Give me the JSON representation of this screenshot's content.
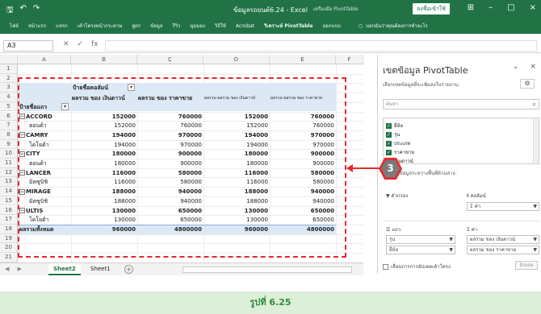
{
  "window": {
    "title": "ข้อมูลรถยนต์6.24 - Excel",
    "context_tab": "เครื่องมือ PivotTable",
    "signin": "ลงชื่อเข้าใช้",
    "controls": [
      "⊞",
      "–",
      "□",
      "×"
    ]
  },
  "quick_access": [
    "🖫",
    "↶",
    "↷"
  ],
  "ribbon_tabs": [
    "ไฟล์",
    "หน้าแรก",
    "แทรก",
    "เค้าโครงหน้ากระดาษ",
    "สูตร",
    "ข้อมูล",
    "รีวิว",
    "มุมมอง",
    "วิธีใช้",
    "Acrobat",
    "วิเคราะห์ PivotTable",
    "ออกแบบ"
  ],
  "tellme": "บอกฉันว่าคุณต้องการทำอะไร",
  "formula_bar": {
    "name_box": "A3",
    "icons": [
      "✕",
      "✓",
      "fx"
    ],
    "content": ""
  },
  "grid": {
    "columns": [
      "A",
      "B",
      "C",
      "D",
      "E",
      "F"
    ],
    "rows": [
      "1",
      "2",
      "3",
      "4",
      "5",
      "6",
      "7",
      "8",
      "9",
      "10",
      "11",
      "12",
      "13",
      "14",
      "15",
      "16",
      "17",
      "18",
      "19",
      "20",
      "21"
    ],
    "pivot": {
      "col_field_label": "ป้ายชื่อคอลัมน์",
      "row_field_label": "ป้ายชื่อแถว",
      "value_headers": [
        "ผลรวม ของ เงินดาวน์",
        "ผลรวม ของ ราคาขาย",
        "ผลรวม ผลรวม ของ เงินดาวน์",
        "ผลรวม ผลรวม ของ ราคาขาย"
      ],
      "rows": [
        {
          "label": "ACCORD",
          "bold": true,
          "values": [
            "152000",
            "760000",
            "152000",
            "760000"
          ]
        },
        {
          "label": "ฮอนด้า",
          "bold": false,
          "values": [
            "152000",
            "760000",
            "152000",
            "760000"
          ]
        },
        {
          "label": "CAMRY",
          "bold": true,
          "values": [
            "194000",
            "970000",
            "194000",
            "970000"
          ]
        },
        {
          "label": "โตโยต้า",
          "bold": false,
          "values": [
            "194000",
            "970000",
            "194000",
            "970000"
          ]
        },
        {
          "label": "CITY",
          "bold": true,
          "values": [
            "180000",
            "900000",
            "180000",
            "900000"
          ]
        },
        {
          "label": "ฮอนด้า",
          "bold": false,
          "values": [
            "180000",
            "900000",
            "180000",
            "900000"
          ]
        },
        {
          "label": "LANCER",
          "bold": true,
          "values": [
            "116000",
            "580000",
            "116000",
            "580000"
          ]
        },
        {
          "label": "มิตซูบิชิ",
          "bold": false,
          "values": [
            "116000",
            "580000",
            "116000",
            "580000"
          ]
        },
        {
          "label": "MIRAGE",
          "bold": true,
          "values": [
            "188000",
            "940000",
            "188000",
            "940000"
          ]
        },
        {
          "label": "มิตซูบิชิ",
          "bold": false,
          "values": [
            "188000",
            "940000",
            "188000",
            "940000"
          ]
        },
        {
          "label": "ULTIS",
          "bold": true,
          "values": [
            "130000",
            "650000",
            "130000",
            "650000"
          ]
        },
        {
          "label": "โตโยต้า",
          "bold": false,
          "values": [
            "130000",
            "650000",
            "130000",
            "650000"
          ]
        }
      ],
      "total": {
        "label": "ผลรวมทั้งหมด",
        "values": [
          "960000",
          "4800000",
          "960000",
          "4800000"
        ]
      }
    }
  },
  "sheets": {
    "nav": "◀ ▶",
    "tabs": [
      "Sheet2",
      "Sheet1"
    ],
    "active": "Sheet2",
    "add": "+"
  },
  "pane": {
    "title": "เขตข้อมูล PivotTable",
    "controls": [
      "⌄",
      "×"
    ],
    "subtitle": "เลือกเขตข้อมูลที่จะเพิ่มลงในรายงาน:",
    "gear": "⚙",
    "search_placeholder": "ค้นหา",
    "search_icon": "⌕",
    "fields": [
      "ยี่ห้อ",
      "รุ่น",
      "ประเภท",
      "ราคาขาย",
      "เงินดาวน์"
    ],
    "drag_hint": "ลากเขตข้อมูลระหว่างพื้นที่ด้านล่าง:",
    "areas": {
      "filters": {
        "label": "ตัวกรอง",
        "icon": "▼"
      },
      "columns": {
        "label": "คอลัมน์",
        "icon": "⦀",
        "items": [
          "Σ ค่า"
        ]
      },
      "rows": {
        "label": "แถว",
        "icon": "☰",
        "items": [
          "รุ่น",
          "ยี่ห้อ"
        ]
      },
      "values": {
        "label": "ค่า",
        "icon": "Σ",
        "items": [
          "ผลรวม ของ เงินดาวน์",
          "ผลรวม ของ ราคาขาย"
        ]
      }
    },
    "defer_label": "เลื่อนการการอัปเดตเค้าโครง",
    "update_button": "อัปเดต"
  },
  "callout": {
    "number": "3"
  },
  "caption": "รูปที่ 6.25",
  "colors": {
    "excel_green": "#217346",
    "callout_red": "#e8292b",
    "pivot_blue": "#dde8f5",
    "caption_bg": "#dcefd9",
    "caption_text": "#2f8a3c"
  }
}
